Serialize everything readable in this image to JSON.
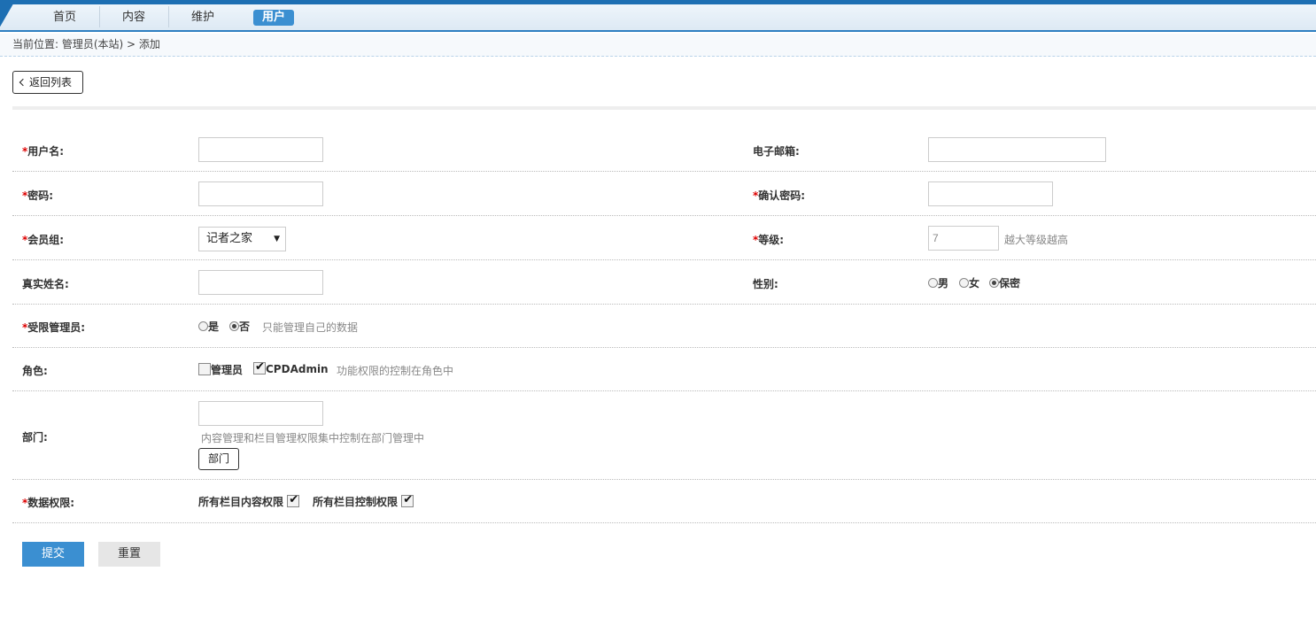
{
  "nav": {
    "items": [
      {
        "label": "首页"
      },
      {
        "label": "内容"
      },
      {
        "label": "维护"
      },
      {
        "label": "用户"
      }
    ],
    "active": "用户"
  },
  "breadcrumb": "当前位置: 管理员(本站) > 添加",
  "back_button": "返回列表",
  "form": {
    "username": {
      "label": "用户名:",
      "required": "*",
      "value": ""
    },
    "email": {
      "label": "电子邮箱:",
      "value": ""
    },
    "password": {
      "label": "密码:",
      "required": "*",
      "value": ""
    },
    "confirm_password": {
      "label": "确认密码:",
      "required": "*",
      "value": ""
    },
    "group": {
      "label": "会员组:",
      "required": "*",
      "selected": "记者之家"
    },
    "level": {
      "label": "等级:",
      "required": "*",
      "value": "7",
      "hint": "越大等级越高"
    },
    "realname": {
      "label": "真实姓名:",
      "value": ""
    },
    "gender": {
      "label": "性别:",
      "options": [
        "男",
        "女",
        "保密"
      ],
      "selected": "保密"
    },
    "restricted": {
      "label": "受限管理员:",
      "required": "*",
      "options": [
        "是",
        "否"
      ],
      "selected": "否",
      "hint": "只能管理自己的数据"
    },
    "role": {
      "label": "角色:",
      "options": [
        {
          "label": "管理员",
          "checked": false
        },
        {
          "label": "CPDAdmin",
          "checked": true
        }
      ],
      "hint": "功能权限的控制在角色中"
    },
    "department": {
      "label": "部门:",
      "value": "",
      "hint": "内容管理和栏目管理权限集中控制在部门管理中",
      "button": "部门"
    },
    "data_permission": {
      "label": "数据权限:",
      "required": "*",
      "options": [
        {
          "label": "所有栏目内容权限",
          "checked": true
        },
        {
          "label": "所有栏目控制权限",
          "checked": true
        }
      ]
    }
  },
  "actions": {
    "submit": "提交",
    "reset": "重置"
  },
  "colors": {
    "accent": "#3b8fd1",
    "topbar": "#1d6fb3",
    "required": "#dd0000"
  }
}
